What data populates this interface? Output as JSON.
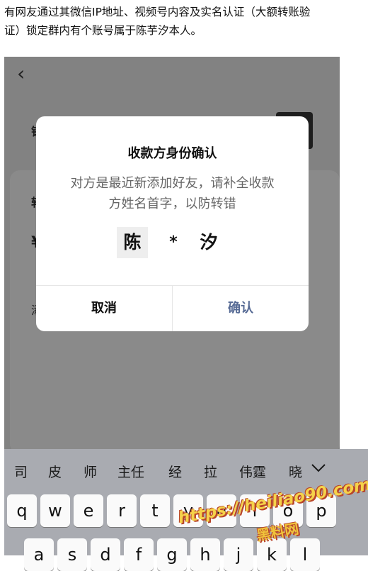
{
  "article": {
    "line1": "有网友通过其微信IP地址、视频号内容及实名认证（大额转账验",
    "line2": "证）锁定群内有个账号属于陈芋汐本人。"
  },
  "screen": {
    "back_glyph": "‹",
    "side_glyphs": [
      "钱",
      "转",
      "¥",
      "添"
    ]
  },
  "dialog": {
    "title": "收款方身份确认",
    "message_line1": "对方是最近新添加好友，请补全收款",
    "message_line2": "方姓名首字，以防转错",
    "name_first": "陈",
    "name_mask": "*",
    "name_last": "汐",
    "cancel_label": "取消",
    "confirm_label": "确认"
  },
  "keyboard": {
    "suggestions": [
      "司",
      "皮",
      "师",
      "主任",
      "经",
      "拉",
      "伟霆",
      "晓"
    ],
    "collapse_icon": "chevron-down-icon",
    "row1": [
      "q",
      "w",
      "e",
      "r",
      "t",
      "y",
      "u",
      "i",
      "o",
      "p"
    ],
    "row2": [
      "a",
      "s",
      "d",
      "f",
      "g",
      "h",
      "j",
      "k",
      "l"
    ]
  },
  "watermark": {
    "url": "https://heiliao90.com",
    "name": "黑料网"
  }
}
